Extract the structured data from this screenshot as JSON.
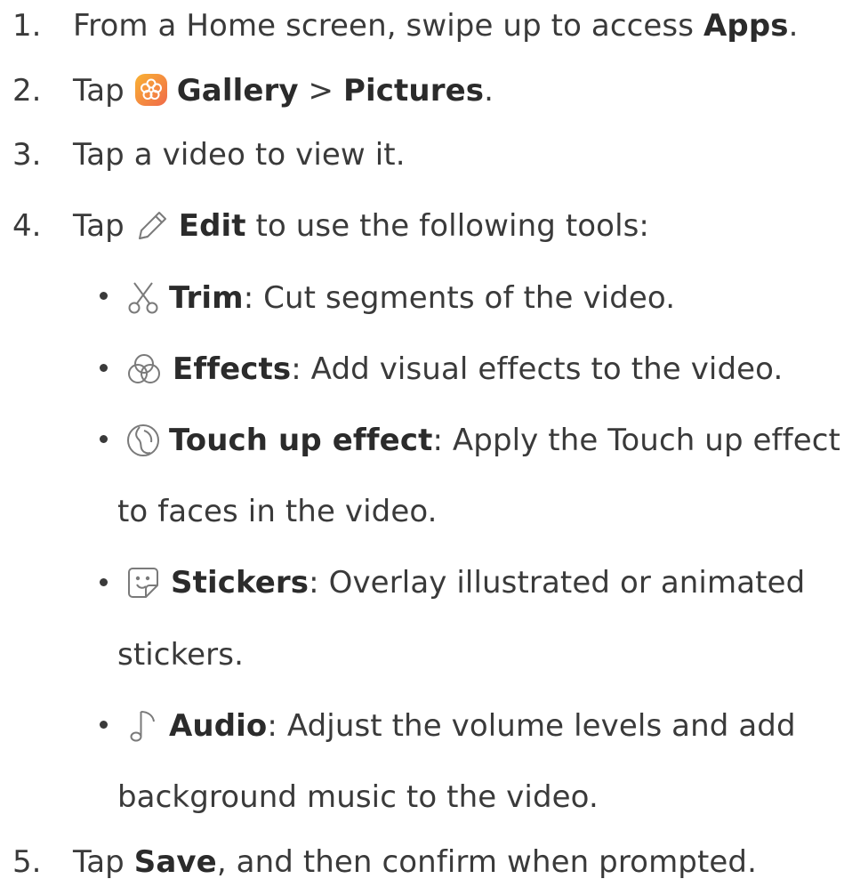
{
  "steps": [
    {
      "num": "1.",
      "pre": "From a Home screen, swipe up to access ",
      "bold": "Apps",
      "post": "."
    },
    {
      "num": "2.",
      "pre": "Tap ",
      "bold1": "Gallery",
      "sep": " > ",
      "bold2": "Pictures",
      "post": ".",
      "icon": "gallery-app-icon"
    },
    {
      "num": "3.",
      "text": "Tap a video to view it."
    },
    {
      "num": "4.",
      "pre": "Tap ",
      "bold": "Edit",
      "post": " to use the following tools:",
      "icon": "pencil-edit-icon"
    },
    {
      "num": "5.",
      "pre": "Tap ",
      "bold": "Save",
      "post": ", and then confirm when prompted."
    }
  ],
  "tools": [
    {
      "icon": "scissors-icon",
      "name": "Trim",
      "desc": ": Cut segments of the video."
    },
    {
      "icon": "effects-circles-icon",
      "name": "Effects",
      "desc": ": Add visual effects to the video."
    },
    {
      "icon": "face-touch-icon",
      "name": "Touch up effect",
      "desc": ": Apply the Touch up effect",
      "desc2": "to faces in the video."
    },
    {
      "icon": "sticker-smile-icon",
      "name": "Stickers",
      "desc": ": Overlay illustrated or animated",
      "desc2": "stickers."
    },
    {
      "icon": "music-note-icon",
      "name": "Audio",
      "desc": ": Adjust the volume levels and add",
      "desc2": "background music to the video."
    }
  ],
  "colors": {
    "text": "#3a3a3a",
    "gallery_icon_start": "#f7a12a",
    "gallery_icon_end": "#f05a7a"
  }
}
